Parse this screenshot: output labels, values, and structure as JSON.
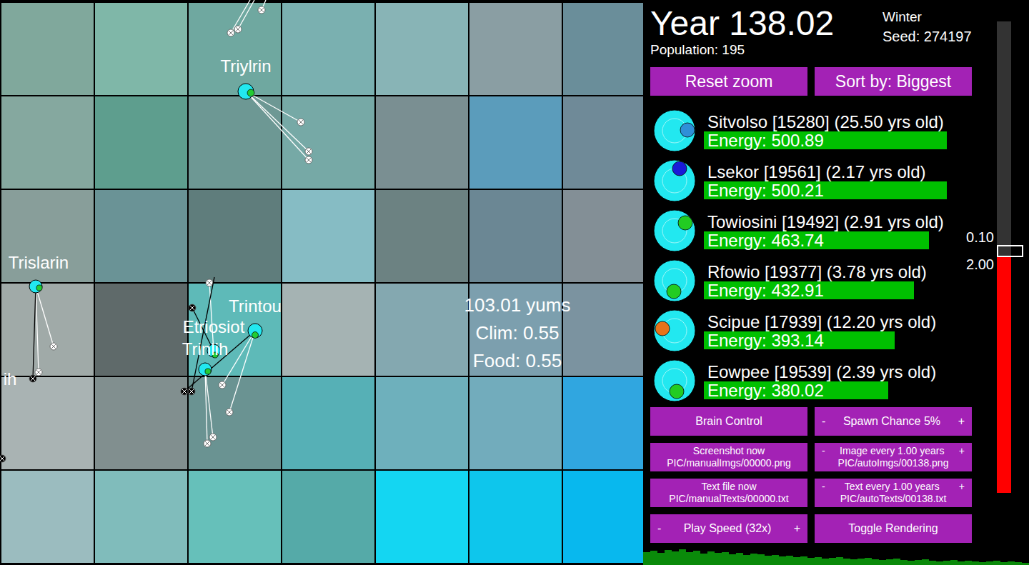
{
  "map": {
    "tiles": [
      [
        {
          "color": "#80a89c"
        },
        {
          "color": "#7fb7a8"
        },
        {
          "color": "#6fa8a0"
        },
        {
          "color": "#7ab0b0"
        },
        {
          "color": "#88b4b6"
        },
        {
          "color": "#8a9ea3"
        },
        {
          "color": "#6a8e9a"
        }
      ],
      [
        {
          "color": "#85a89f"
        },
        {
          "color": "#5e9e8e"
        },
        {
          "color": "#6d9894"
        },
        {
          "color": "#76a9a6"
        },
        {
          "color": "#7a8f92"
        },
        {
          "color": "#5b9cbb"
        },
        {
          "color": "#6f8a98"
        }
      ],
      [
        {
          "color": "#889e9a"
        },
        {
          "color": "#6a9396"
        },
        {
          "color": "#5f7d7c"
        },
        {
          "color": "#86bcc4"
        },
        {
          "color": "#6c8282"
        },
        {
          "color": "#6b8794"
        },
        {
          "color": "#838f96"
        }
      ],
      [
        {
          "color": "#a0aaa8"
        },
        {
          "color": "#5f6a6a"
        },
        {
          "color": "#5ebab8"
        },
        {
          "color": "#a5b3b3"
        },
        {
          "color": "#84a8b0"
        },
        {
          "color": "#7c9fae"
        },
        {
          "color": "#7b93a0"
        }
      ],
      [
        {
          "color": "#a9b3b3"
        },
        {
          "color": "#818f8f"
        },
        {
          "color": "#6a9392"
        },
        {
          "color": "#56b0b6"
        },
        {
          "color": "#6eb0bc"
        },
        {
          "color": "#72acbc"
        },
        {
          "color": "#30a6e0"
        }
      ],
      [
        {
          "color": "#9bbcbf"
        },
        {
          "color": "#80bcbb"
        },
        {
          "color": "#66c0ba"
        },
        {
          "color": "#55aaa8"
        },
        {
          "color": "#14d6f2"
        },
        {
          "color": "#0ec6ec"
        },
        {
          "color": "#08b8ee"
        }
      ]
    ],
    "tile_info": {
      "lines": [
        "103.01 yums",
        "Clim: 0.55",
        "Food: 0.55"
      ]
    },
    "creatures": [
      {
        "name": "Triylrin"
      },
      {
        "name": "Trislarin"
      },
      {
        "name": "Trintou"
      },
      {
        "name": "Etriosiot"
      },
      {
        "name": "Trinlih"
      },
      {
        "name": "ih"
      }
    ]
  },
  "panel": {
    "year": "Year 138.02",
    "season": "Winter",
    "seed": "Seed: 274197",
    "population": "Population: 195",
    "buttons": [
      "Reset zoom",
      "Sort by: Biggest"
    ],
    "creature_list": [
      {
        "name": "Sitvolso [15280] (25.50 yrs old)",
        "energy": "Energy: 500.89",
        "level": 1.0,
        "color": "#2f8fd8"
      },
      {
        "name": "Lsekor [19561] (2.17 yrs old)",
        "energy": "Energy: 500.21",
        "level": 1.0,
        "color": "#1a1ad8"
      },
      {
        "name": "Towiosini [19492] (2.91 yrs old)",
        "energy": "Energy: 463.74",
        "level": 0.926,
        "color": "#22cc22"
      },
      {
        "name": "Rfowio [19377] (3.78 yrs old)",
        "energy": "Energy: 432.91",
        "level": 0.865,
        "color": "#22cc22"
      },
      {
        "name": "Scipue [17939] (12.20 yrs old)",
        "energy": "Energy: 393.14",
        "level": 0.785,
        "color": "#e8731a"
      },
      {
        "name": "Eowpee [19539] (2.39 yrs old)",
        "energy": "Energy: 380.02",
        "level": 0.759,
        "color": "#22cc22"
      }
    ],
    "controls": [
      {
        "kind": "plain",
        "lines": [
          "Brain Control"
        ]
      },
      {
        "kind": "stepper",
        "minus": "-",
        "lines": [
          "Spawn Chance 5%"
        ],
        "plus": "+"
      },
      {
        "kind": "plain",
        "lines": [
          "Screenshot now",
          "PIC/manualImgs/00000.png"
        ]
      },
      {
        "kind": "stepper",
        "minus": "-",
        "lines": [
          "Image every 1.00 years",
          "PIC/autoImgs/00138.png"
        ],
        "plus": "+"
      },
      {
        "kind": "plain",
        "lines": [
          "Text file now",
          "PIC/manualTexts/00000.txt"
        ]
      },
      {
        "kind": "stepper",
        "minus": "-",
        "lines": [
          "Text every 1.00 years",
          "PIC/autoTexts/00138.txt"
        ],
        "plus": "+"
      },
      {
        "kind": "stepper",
        "minus": "-",
        "lines": [
          "Play Speed (32x)"
        ],
        "plus": "+"
      },
      {
        "kind": "plain",
        "lines": [
          "Toggle Rendering"
        ]
      }
    ],
    "slider": {
      "labels": [
        "0.10",
        "2.00"
      ],
      "level": 0.5
    },
    "histogram": {
      "values": [
        18,
        20,
        17,
        21,
        19,
        22,
        18,
        20,
        16,
        19,
        17,
        18,
        15,
        17,
        14,
        16,
        15,
        13,
        14,
        12,
        13,
        11,
        12,
        10,
        11,
        9,
        10,
        11,
        9,
        8,
        9,
        10,
        8,
        7,
        8,
        9,
        7,
        6,
        7,
        8,
        6,
        5,
        6,
        7,
        5,
        6,
        5,
        4,
        5,
        6,
        4,
        5,
        4,
        3
      ]
    }
  }
}
